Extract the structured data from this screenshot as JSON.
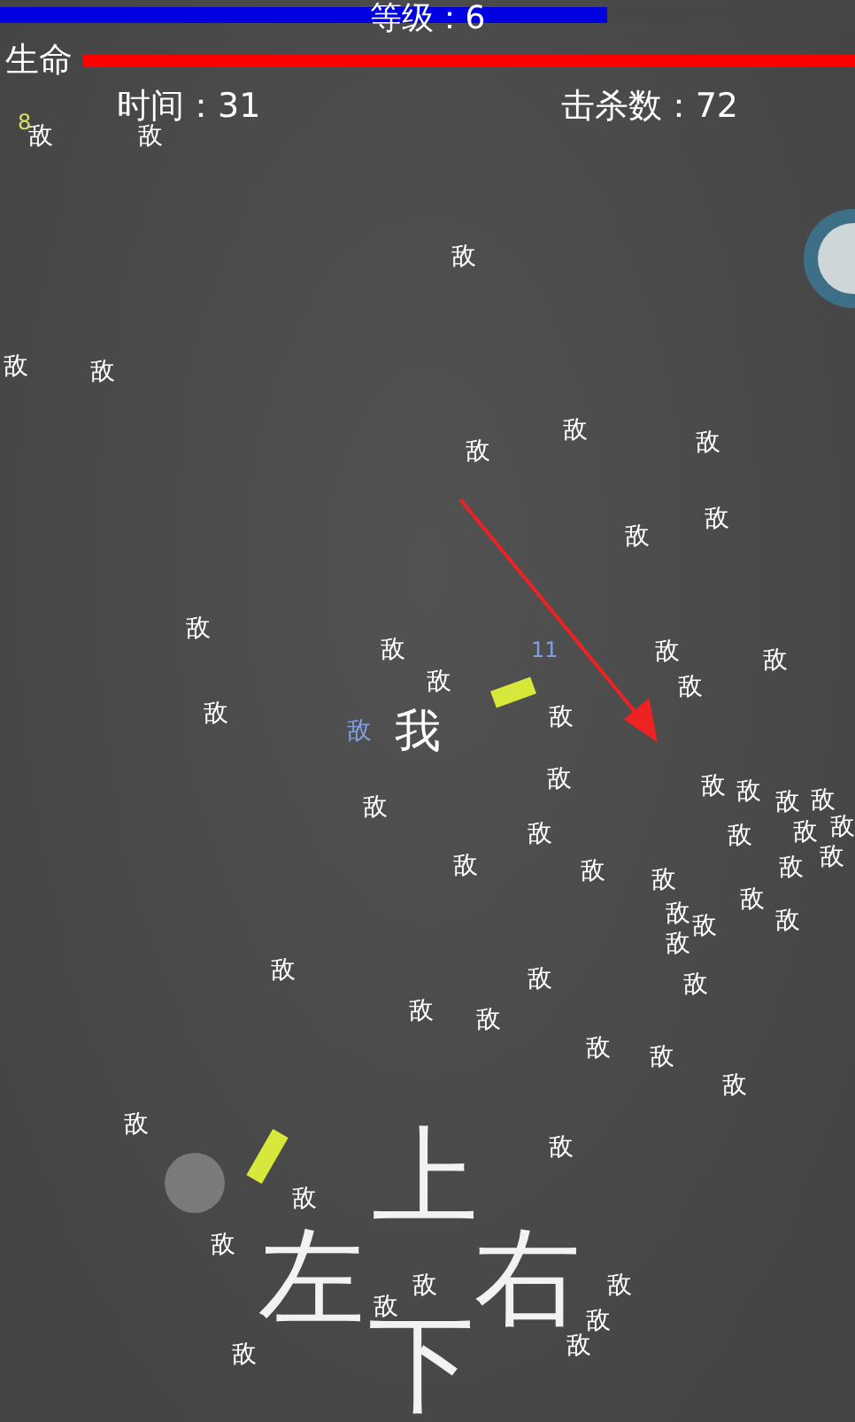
{
  "hud": {
    "level_label": "等级：6",
    "experience": {
      "level": 0.71
    },
    "life_label": "生命",
    "life": {
      "level": 1
    },
    "time_label": "时间：31",
    "kills_label": "击杀数：72"
  },
  "player": {
    "label": "我"
  },
  "damage_numbers": [
    "8",
    "11"
  ],
  "enemies": [
    {
      "label": "敌",
      "color": "#ffffff"
    },
    {
      "label": "敌",
      "color": "#ffffff"
    },
    {
      "label": "敌",
      "color": "#ffffff"
    },
    {
      "label": "敌",
      "color": "#ffffff"
    },
    {
      "label": "敌",
      "color": "#ffffff"
    },
    {
      "label": "敌",
      "color": "#ffffff"
    },
    {
      "label": "敌",
      "color": "#ffffff"
    },
    {
      "label": "敌",
      "color": "#ffffff"
    },
    {
      "label": "敌",
      "color": "#ffffff"
    },
    {
      "label": "敌",
      "color": "#ffffff"
    },
    {
      "label": "敌",
      "color": "#ffffff"
    },
    {
      "label": "敌",
      "color": "#ffffff"
    },
    {
      "label": "敌",
      "color": "#ffffff"
    },
    {
      "label": "敌",
      "color": "#ffffff"
    },
    {
      "label": "敌",
      "color": "#ffffff"
    },
    {
      "label": "敌",
      "color": "#ffffff"
    },
    {
      "label": "敌",
      "color": "#ffffff"
    },
    {
      "label": "敌",
      "color": "#ffffff"
    },
    {
      "label": "敌",
      "color": "#ffffff"
    },
    {
      "label": "敌",
      "color": "#ffffff"
    },
    {
      "label": "敌",
      "color": "#ffffff"
    },
    {
      "label": "敌",
      "color": "#ffffff"
    },
    {
      "label": "敌",
      "color": "#ffffff"
    },
    {
      "label": "敌",
      "color": "#ffffff"
    },
    {
      "label": "敌",
      "color": "#ffffff"
    },
    {
      "label": "敌",
      "color": "#ffffff"
    },
    {
      "label": "敌",
      "color": "#ffffff"
    },
    {
      "label": "敌",
      "color": "#ffffff"
    },
    {
      "label": "敌",
      "color": "#ffffff"
    },
    {
      "label": "敌",
      "color": "#ffffff"
    },
    {
      "label": "敌",
      "color": "#ffffff"
    },
    {
      "label": "敌",
      "color": "#ffffff"
    },
    {
      "label": "敌",
      "color": "#ffffff"
    },
    {
      "label": "敌",
      "color": "#ffffff"
    },
    {
      "label": "敌",
      "color": "#ffffff"
    },
    {
      "label": "敌",
      "color": "#ffffff"
    },
    {
      "label": "敌",
      "color": "#ffffff"
    },
    {
      "label": "敌",
      "color": "#ffffff"
    },
    {
      "label": "敌",
      "color": "#ffffff"
    },
    {
      "label": "敌",
      "color": "#ffffff"
    },
    {
      "label": "敌",
      "color": "#ffffff"
    },
    {
      "label": "敌",
      "color": "#ffffff"
    },
    {
      "label": "敌",
      "color": "#ffffff"
    },
    {
      "label": "敌",
      "color": "#ffffff"
    },
    {
      "label": "敌",
      "color": "#ffffff"
    },
    {
      "label": "敌",
      "color": "#ffffff"
    },
    {
      "label": "敌",
      "color": "#ffffff"
    },
    {
      "label": "敌",
      "color": "#ffffff"
    },
    {
      "label": "敌",
      "color": "#ffffff"
    },
    {
      "label": "敌",
      "color": "#ffffff"
    },
    {
      "label": "敌",
      "color": "#ffffff"
    },
    {
      "label": "敌",
      "color": "#ffffff"
    },
    {
      "label": "敌",
      "color": "#ffffff"
    },
    {
      "label": "敌",
      "color": "#ffffff"
    },
    {
      "label": "敌",
      "color": "#ffffff"
    },
    {
      "label": "敌",
      "color": "#ffffff"
    },
    {
      "label": "敌",
      "color": "#7f9fe0"
    }
  ],
  "controls": [
    {
      "kind": "up",
      "label": "上"
    },
    {
      "kind": "left",
      "label": "左"
    },
    {
      "kind": "right",
      "label": "右"
    },
    {
      "kind": "down",
      "label": "下"
    }
  ]
}
